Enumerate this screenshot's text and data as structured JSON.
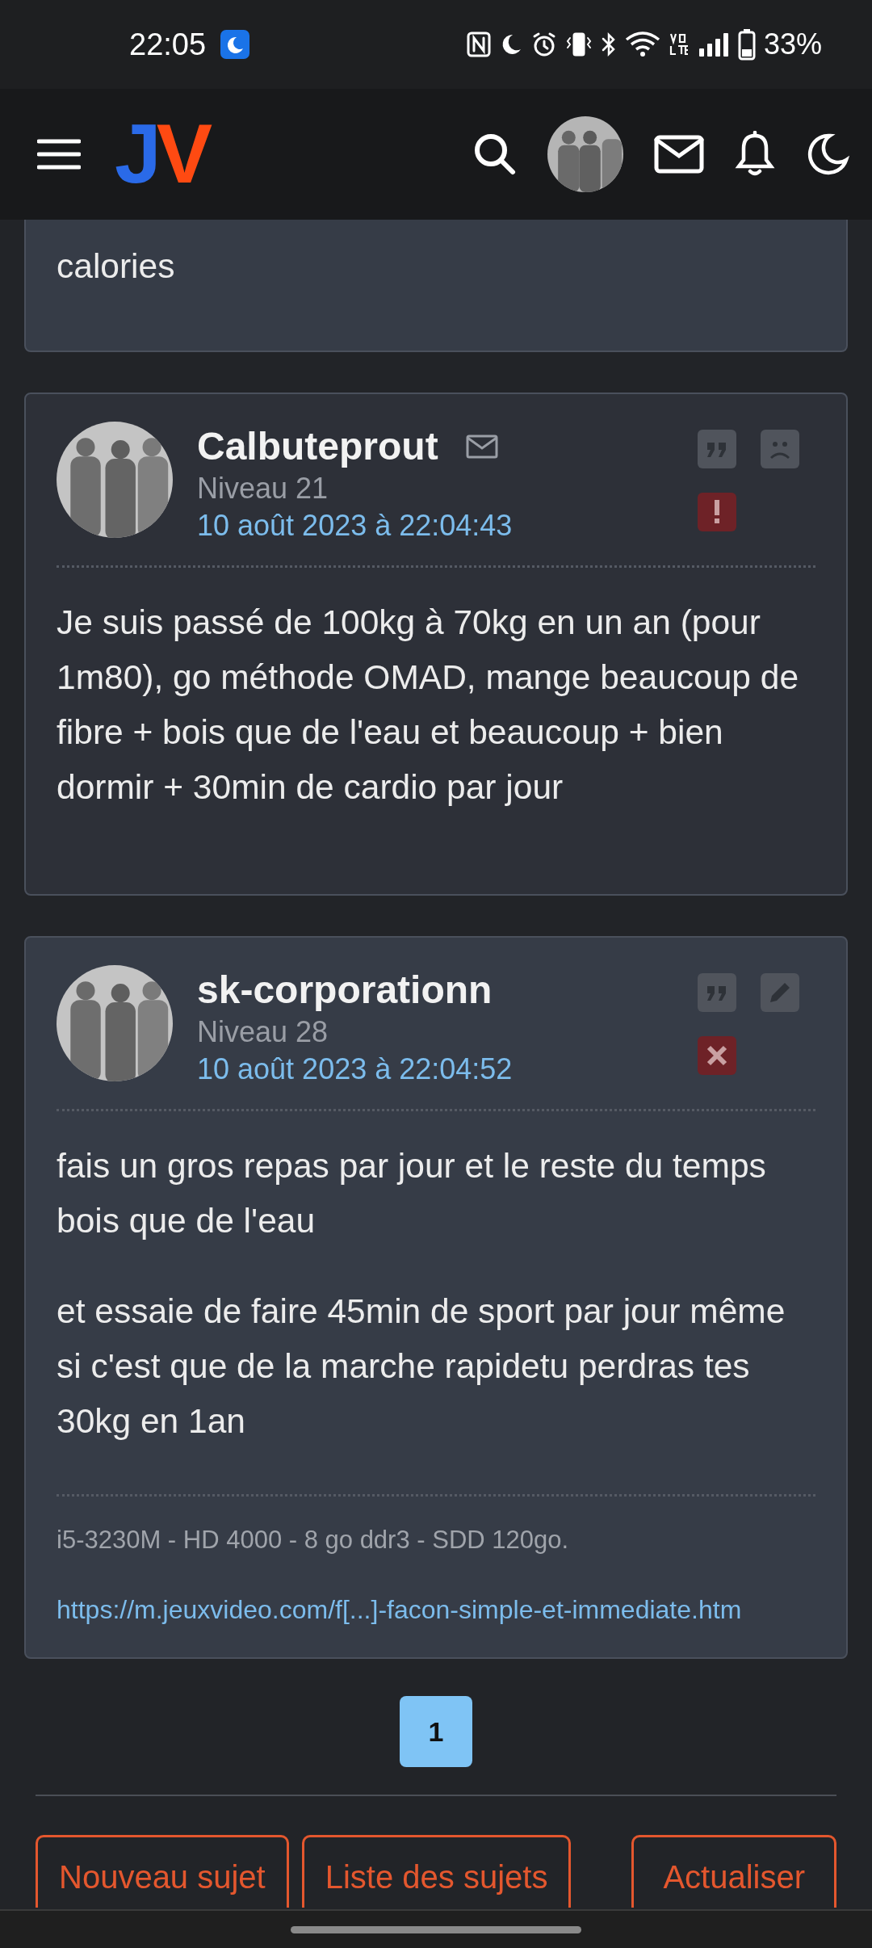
{
  "status_bar": {
    "time": "22:05",
    "battery": "33%"
  },
  "header": {
    "logo": [
      "J",
      "V"
    ]
  },
  "previous_post": {
    "body": "calories"
  },
  "posts": [
    {
      "author": "Calbuteprout",
      "messageable": true,
      "own": false,
      "level": "Niveau 21",
      "date": "10 août 2023 à 22:04:43",
      "body": [
        "Je suis passé de 100kg à 70kg en un an (pour 1m80), go méthode OMAD, mange beaucoup de fibre + bois que de l'eau et beaucoup + bien dormir + 30min de cardio par jour"
      ],
      "actions": [
        {
          "kind": "quote"
        },
        {
          "kind": "sad"
        },
        {
          "kind": "report"
        }
      ]
    },
    {
      "author": "sk-corporationn",
      "messageable": false,
      "own": true,
      "level": "Niveau 28",
      "date": "10 août 2023 à 22:04:52",
      "body": [
        "fais un gros repas par jour et le reste du temps bois que de l'eau",
        "et essaie de faire 45min de sport par jour même si c'est que de la marche rapidetu perdras tes 30kg en 1an"
      ],
      "signature": "i5-3230M - HD 4000 - 8 go ddr3 - SDD 120go.",
      "link": "https://m.jeuxvideo.com/f[...]-facon-simple-et-immediate.htm",
      "actions": [
        {
          "kind": "quote"
        },
        {
          "kind": "edit"
        },
        {
          "kind": "delete"
        }
      ]
    }
  ],
  "pagination": [
    {
      "label": "1",
      "selected": true
    }
  ],
  "buttons": [
    "Nouveau sujet",
    "Liste des sujets",
    "Actualiser"
  ]
}
